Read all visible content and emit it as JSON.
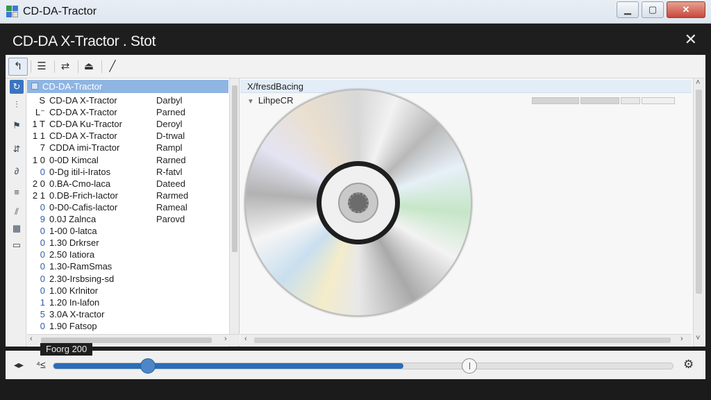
{
  "os_window": {
    "title": "CD-DA-Tractor",
    "minimize": "▁",
    "maximize": "▢",
    "close": "✕"
  },
  "app": {
    "title": "CD-DA X-Tractor . Stot",
    "close": "✕"
  },
  "toolbar": {
    "buttons": [
      {
        "icon": "select-cursor-icon",
        "glyph": "↰"
      },
      {
        "icon": "list-view-icon",
        "glyph": "☰"
      },
      {
        "icon": "transfer-icon",
        "glyph": "⇄"
      },
      {
        "icon": "eject-drive-icon",
        "glyph": "⏏"
      },
      {
        "icon": "pen-icon",
        "glyph": "╱"
      }
    ]
  },
  "sidebar_icons": [
    {
      "icon": "refresh-icon",
      "glyph": "↻"
    },
    {
      "icon": "equalizer-icon",
      "glyph": "⫶"
    },
    {
      "icon": "tag-icon",
      "glyph": "⚑"
    },
    {
      "icon": "sliders-icon",
      "glyph": "⇵"
    },
    {
      "icon": "script-icon",
      "glyph": "∂"
    },
    {
      "icon": "stack-icon",
      "glyph": "≡"
    },
    {
      "icon": "split-icon",
      "glyph": "⫽"
    },
    {
      "icon": "grid-icon",
      "glyph": "▦"
    },
    {
      "icon": "window-icon",
      "glyph": "▭"
    }
  ],
  "track_list": {
    "header": "CD-DA-Tractor",
    "rows": [
      {
        "idx": "S",
        "name": "CD-DA X-Tractor",
        "status": "Darbyl",
        "blue": false
      },
      {
        "idx": "L⁻",
        "name": "CD-DA X-Tractor",
        "status": "Parned",
        "blue": false
      },
      {
        "idx": "1 T",
        "name": "CD-DA Ku-Tractor",
        "status": "Deroyl",
        "blue": false
      },
      {
        "idx": "1 1",
        "name": "CD-DA X-Tractor",
        "status": "D-trwal",
        "blue": false
      },
      {
        "idx": "7",
        "name": "CDDA imi-Tractor",
        "status": "Rampl",
        "blue": false
      },
      {
        "idx": "1 0",
        "name": "0-0D Kimcal",
        "status": "Rarned",
        "blue": false
      },
      {
        "idx": "0",
        "name": "0-Dg itil-i-Iratos",
        "status": "R-fatvl",
        "blue": true
      },
      {
        "idx": "2 0",
        "name": "0.BA-Cmo-laca",
        "status": "Dateed",
        "blue": false
      },
      {
        "idx": "2 1",
        "name": "0.DB-Frich-Iactor",
        "status": "Rarmed",
        "blue": false
      },
      {
        "idx": "0",
        "name": "0-D0-Cafis-lactor",
        "status": "Rameal",
        "blue": true
      },
      {
        "idx": "9",
        "name": "0.0J Zalnca",
        "status": "Parovd",
        "blue": true
      },
      {
        "idx": "0",
        "name": "1-00 0-latca",
        "status": "",
        "blue": true
      },
      {
        "idx": "0",
        "name": "1.30 Drkrser",
        "status": "",
        "blue": true
      },
      {
        "idx": "0",
        "name": "2.50 Iatiora",
        "status": "",
        "blue": true
      },
      {
        "idx": "0",
        "name": "1.30-RamSmas",
        "status": "",
        "blue": true
      },
      {
        "idx": "0",
        "name": "2.30-Irsbsing-sd",
        "status": "",
        "blue": true
      },
      {
        "idx": "0",
        "name": "1.00 Krlnitor",
        "status": "",
        "blue": true
      },
      {
        "idx": "1",
        "name": "1.20 In-lafon",
        "status": "",
        "blue": true
      },
      {
        "idx": "5",
        "name": "3.0A X-tractor",
        "status": "",
        "blue": true
      },
      {
        "idx": "0",
        "name": "1.90 Fatsop",
        "status": "",
        "blue": true
      }
    ]
  },
  "right_pane": {
    "header": "X/fresdBacing",
    "subitem": "LihpeCR",
    "disc_icon": "compact-disc-icon"
  },
  "tooltip": "Foorg  200",
  "transport": {
    "left_icon": "◂▸",
    "speed_icon": "⁴≤",
    "progress_fraction": 0.565,
    "knob_fraction": 0.152,
    "marker_fraction": 0.672,
    "settings_icon": "⚙"
  },
  "scroll": {
    "left": "‹",
    "right": "›",
    "up": "˄",
    "down": "˅"
  },
  "colors": {
    "accent": "#2a6db8",
    "list_header": "#8fb5e3",
    "title_bar_dark": "#1e1e1e"
  }
}
